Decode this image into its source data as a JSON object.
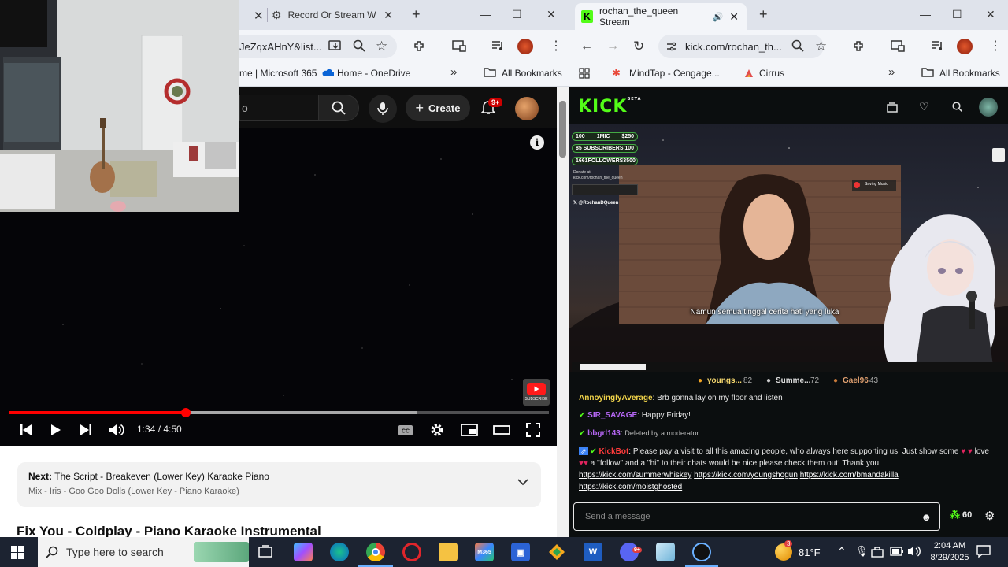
{
  "left_window": {
    "tabs": [
      {
        "label": "Record Or Stream W",
        "close": "✕"
      }
    ],
    "new_tab": "+",
    "window_controls": [
      "—",
      "☐",
      "✕"
    ],
    "address": "JeZqxAHnY&list...",
    "bookmarks": [
      "me | Microsoft 365",
      "Home - OneDrive"
    ],
    "bookmarks_more": "»",
    "all_bookmarks": "All Bookmarks",
    "youtube": {
      "search_placeholder": "o",
      "create_label": "Create",
      "notification_count": "9+",
      "player": {
        "time": "1:34 / 4:50",
        "progress": 0.327,
        "buffered": 0.755,
        "subscribe_label": "SUBSCRIBE"
      },
      "next": {
        "prefix": "Next:",
        "title": "The Script - Breakeven (Lower Key) Karaoke Piano",
        "mix": "Mix - Iris - Goo Goo Dolls (Lower Key - Piano Karaoke)"
      },
      "video_title": "Fix You - Coldplay - Piano Karaoke Instrumental"
    }
  },
  "right_window": {
    "tab_title": "rochan_the_queen Stream",
    "new_tab": "+",
    "window_controls": [
      "—",
      "☐",
      "✕"
    ],
    "address": "kick.com/rochan_th...",
    "bookmarks": [
      "MindTap - Cengage...",
      "Cirrus"
    ],
    "bookmarks_more": "»",
    "all_bookmarks": "All Bookmarks",
    "kick": {
      "logo": "KICK",
      "beta": "BETA",
      "overlay": {
        "rows": [
          {
            "left": "100",
            "mid": "1MIC",
            "right": "$250"
          },
          {
            "left": "85",
            "mid": "SUBSCRIBERS",
            "right": "100"
          },
          {
            "left": "1661",
            "mid": "FOLLOWERS",
            "right": "3500"
          }
        ],
        "donate": "Donate at",
        "donate_url": "kick.com/rochan_the_queen",
        "handle": "@RochanDQueen",
        "now_playing": "Saving Music"
      },
      "subtitle": "Namun semua tinggal cerita hati yang luka",
      "gifters": [
        {
          "name": "youngs...",
          "count": "82"
        },
        {
          "name": "Summe...",
          "count": "72"
        },
        {
          "name": "Gael96",
          "count": "43"
        }
      ],
      "chat": [
        {
          "user": "AnnoyinglyAverage",
          "color": "#f0d34a",
          "text": "Brb gonna lay on my floor and listen"
        },
        {
          "user": "SIR_SAVAGE",
          "color": "#b667f5",
          "text": "Happy Friday!"
        },
        {
          "user": "bbgrl143",
          "color": "#b667f5",
          "text": "Deleted by a moderator"
        },
        {
          "user": "KickBot",
          "color": "#ff3b3b",
          "text": "Please pay a visit to all this amazing people, who always here supporting us. Just show some",
          "text2": "love",
          "text3": "a ''follow'' and a ''hi'' to their chats would be nice please check them out! Thank you."
        }
      ],
      "links": [
        "https://kick.com/summerwhiskey",
        "https://kick.com/youngshogun",
        "https://kick.com/bmandakilla",
        "https://kick.com/moistghosted"
      ],
      "message_placeholder": "Send a message",
      "points": "60"
    }
  },
  "taskbar": {
    "search_placeholder": "Type here to search",
    "weather": "81°F",
    "weather_badge": "3",
    "time": "2:04 AM",
    "date": "8/29/2025",
    "word_label": "W",
    "m365_label": "M365",
    "discord_badge": "9+"
  },
  "colors": {
    "kick_green": "#53fc18",
    "yt_red": "#ff0000",
    "taskbar": "#1c2331"
  }
}
